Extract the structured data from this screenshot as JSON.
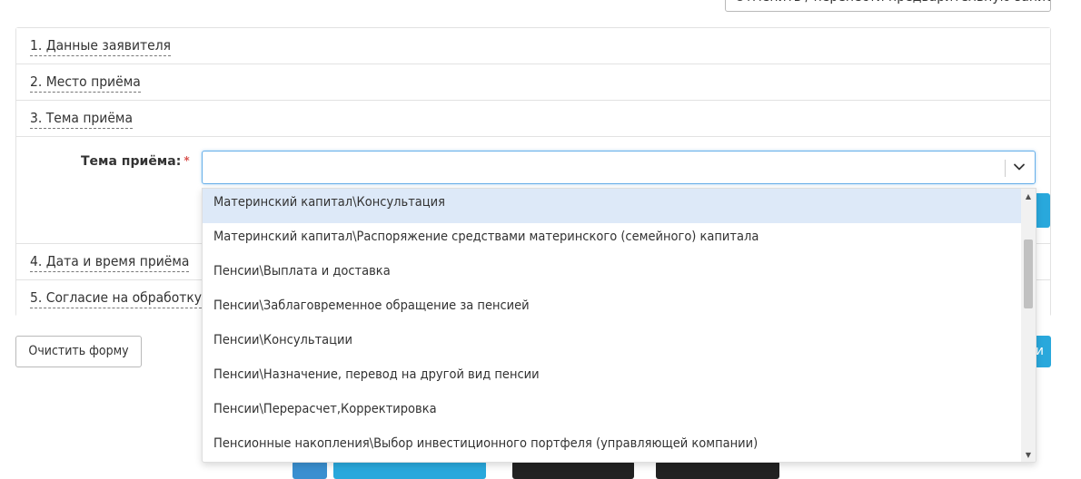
{
  "top_button": {
    "label": "Отменить / перенести предварительную запись"
  },
  "sections": [
    {
      "label": "1. Данные заявителя"
    },
    {
      "label": "2. Место приёма"
    },
    {
      "label": "3. Тема приёма"
    },
    {
      "label": "4. Дата и время приёма"
    },
    {
      "label": "5. Согласие на обработку"
    }
  ],
  "topic_field": {
    "label": "Тема приёма:",
    "required_mark": "*",
    "value": ""
  },
  "dropdown": {
    "options": [
      "Материнский капитал\\Консультация",
      "Материнский капитал\\Распоряжение средствами материнского (семейного) капитала",
      "Пенсии\\Выплата и доставка",
      "Пенсии\\Заблаговременное обращение за пенсией",
      "Пенсии\\Консультации",
      "Пенсии\\Назначение, перевод на другой вид пенсии",
      "Пенсии\\Перерасчет,Корректировка",
      "Пенсионные накопления\\Выбор инвестиционного портфеля (управляющей компании)"
    ],
    "highlighted_index": 0
  },
  "clear_button": {
    "label": "Очистить форму"
  },
  "submit_button": {
    "label": "и"
  },
  "colors": {
    "accent": "#29a8dc",
    "focus_border": "#66afe9",
    "highlight": "#dde9f8",
    "required": "#d9534f"
  }
}
